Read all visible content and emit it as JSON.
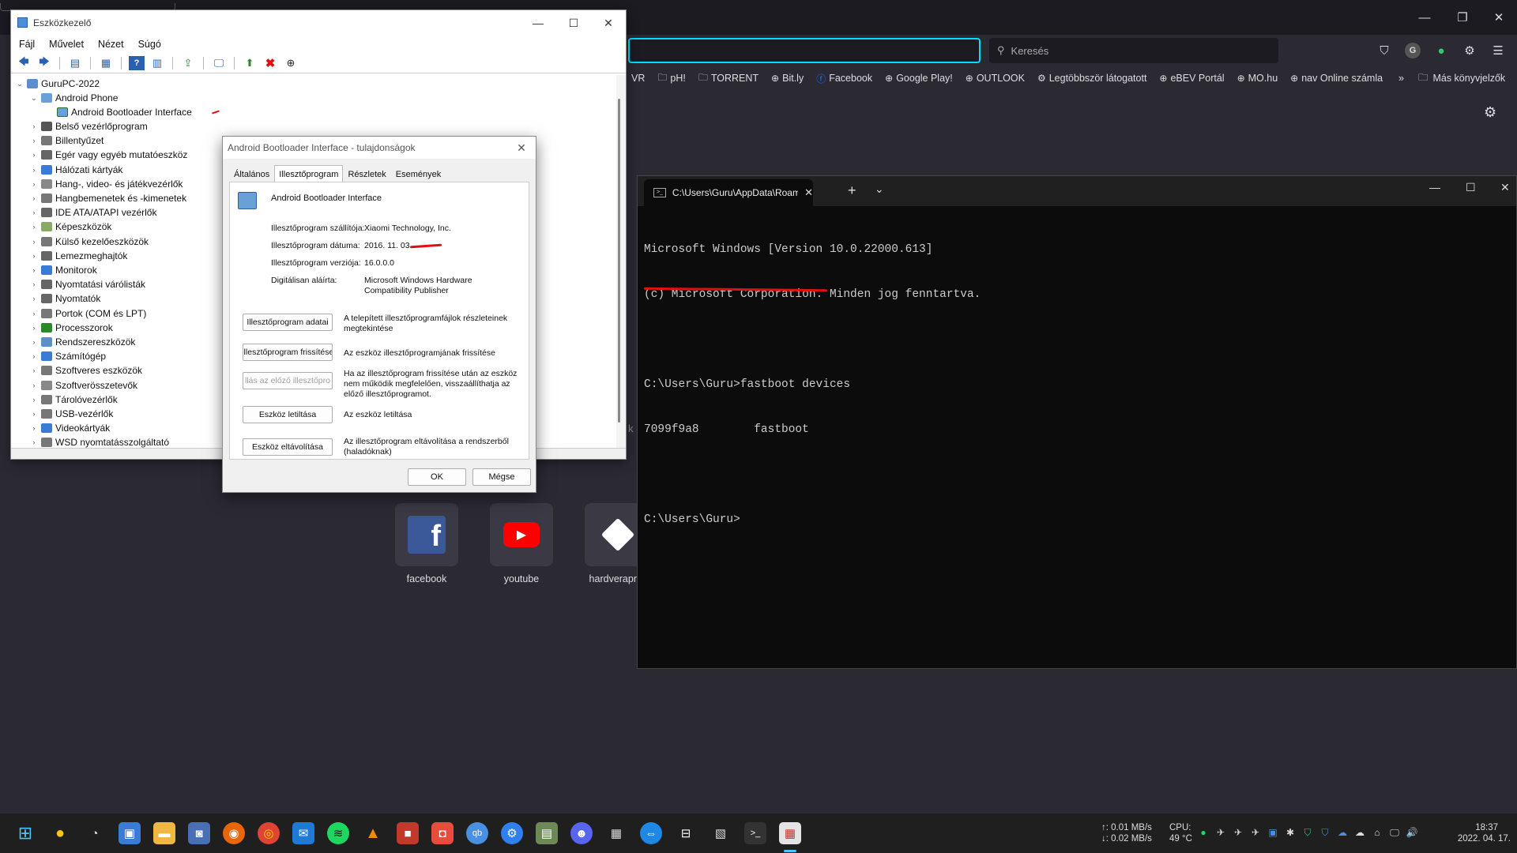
{
  "browser": {
    "search_placeholder": "Keresés",
    "bookmarks": [
      {
        "icon": "folder-icon",
        "label": "VR"
      },
      {
        "icon": "folder-icon",
        "label": "pH!"
      },
      {
        "icon": "folder-icon",
        "label": "TORRENT"
      },
      {
        "icon": "globe-icon",
        "label": "Bit.ly"
      },
      {
        "icon": "facebook-icon",
        "label": "Facebook"
      },
      {
        "icon": "globe-icon",
        "label": "Google Play!"
      },
      {
        "icon": "globe-icon",
        "label": "OUTLOOK"
      },
      {
        "icon": "gear-icon",
        "label": "Legtöbbször látogatott"
      },
      {
        "icon": "globe-icon",
        "label": "eBEV Portál"
      },
      {
        "icon": "globe-icon",
        "label": "MO.hu"
      },
      {
        "icon": "globe-icon",
        "label": "nav Online számla"
      }
    ],
    "other_bookmarks": "Más könyvjelzők",
    "partial_text": "k",
    "shortcuts": [
      {
        "label": "facebook"
      },
      {
        "label": "youtube"
      },
      {
        "label": "hardverapr"
      }
    ]
  },
  "devmgr": {
    "title": "Eszközkezelő",
    "menu": [
      "Fájl",
      "Művelet",
      "Nézet",
      "Súgó"
    ],
    "tree": {
      "root": "GuruPC-2022",
      "android_phone": "Android Phone",
      "android_bootloader": "Android Bootloader Interface",
      "categories": [
        "Belső vezérlőprogram",
        "Billentyűzet",
        "Egér vagy egyéb mutatóeszköz",
        "Hálózati kártyák",
        "Hang-, video- és játékvezérlők",
        "Hangbemenetek és -kimenetek",
        "IDE ATA/ATAPI vezérlők",
        "Képeszközök",
        "Külső kezelőeszközök",
        "Lemezmeghajtók",
        "Monitorok",
        "Nyomtatási várólisták",
        "Nyomtatók",
        "Portok (COM és LPT)",
        "Processzorok",
        "Rendszereszközök",
        "Számítógép",
        "Szoftveres eszközök",
        "Szoftverösszetevők",
        "Tárolóvezérlők",
        "USB-vezérlők",
        "Videokártyák",
        "WSD nyomtatásszolgáltató"
      ]
    }
  },
  "props": {
    "title": "Android Bootloader Interface - tulajdonságok",
    "tabs": [
      "Általános",
      "Illesztőprogram",
      "Részletek",
      "Események"
    ],
    "device_name": "Android Bootloader Interface",
    "fields": [
      {
        "label": "Illesztőprogram szállítója:",
        "value": "Xiaomi Technology, Inc."
      },
      {
        "label": "Illesztőprogram dátuma:",
        "value": "2016. 11. 03."
      },
      {
        "label": "Illesztőprogram verziója:",
        "value": "16.0.0.0"
      },
      {
        "label": "Digitálisan aláírta:",
        "value": "Microsoft Windows Hardware Compatibility Publisher"
      }
    ],
    "actions": [
      {
        "button": "Illesztőprogram adatai",
        "desc": "A telepített illesztőprogramfájlok részleteinek megtekintése"
      },
      {
        "button": "Illesztőprogram frissítése",
        "desc": "Az eszköz illesztőprogramjának frissítése"
      },
      {
        "button": "llás az előző illesztőpro",
        "desc": "Ha az illesztőprogram frissítése után az eszköz nem működik megfelelően, visszaállíthatja az előző illesztőprogramot."
      },
      {
        "button": "Eszköz letiltása",
        "desc": "Az eszköz letiltása"
      },
      {
        "button": "Eszköz eltávolítása",
        "desc": "Az illesztőprogram eltávolítása a rendszerből (haladóknak)"
      }
    ],
    "ok": "OK",
    "cancel": "Mégse"
  },
  "terminal": {
    "tab_title": "C:\\Users\\Guru\\AppData\\Roamir",
    "lines": [
      "Microsoft Windows [Version 10.0.22000.613]",
      "(c) Microsoft Corporation. Minden jog fenntartva.",
      "",
      "C:\\Users\\Guru>fastboot devices",
      "7099f9a8        fastboot",
      "",
      "C:\\Users\\Guru>"
    ]
  },
  "taskbar": {
    "net_up": "↑: 0.01 MB/s",
    "net_down": "↓: 0.02 MB/s",
    "cpu_label": "CPU:",
    "cpu_temp": "49 °C",
    "time": "18:37",
    "date": "2022. 04. 17."
  }
}
